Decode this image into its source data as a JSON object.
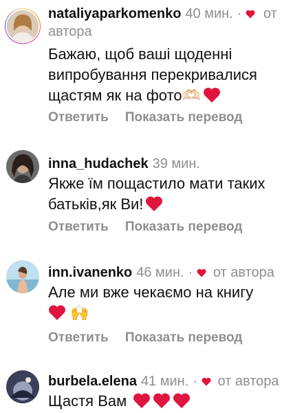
{
  "comments": [
    {
      "username": "nataliyaparkomenko",
      "time": "40 мин.",
      "author_label_line1": "от",
      "author_label_line2": "автора",
      "text": "Бажаю, щоб ваші щоденні випробування перекривалися щастям як на фото🫶🏻",
      "reply": "Ответить",
      "translate": "Показать перевод",
      "avatar_icon": "avatar-photo"
    },
    {
      "username": "inna_hudachek",
      "time": "39 мин.",
      "text": "Якже їм пощастило мати таких батьків,як Ви!",
      "reply": "Ответить",
      "translate": "Показать перевод",
      "avatar_icon": "avatar-photo"
    },
    {
      "username": "inn.ivanenko",
      "time": "46 мин.",
      "dot": "·",
      "author_label": "от автора",
      "text": "Але ми вже чекаємо на книгу",
      "emoji_line2": "🙌",
      "reply": "Ответить",
      "translate": "Показать перевод",
      "avatar_icon": "avatar-photo"
    },
    {
      "username": "burbela.elena",
      "time": "41 мин.",
      "dot": "·",
      "author_label": "от автора",
      "text": "Щастя Вам",
      "avatar_icon": "avatar-photo"
    }
  ],
  "colors": {
    "heart": "#e0143c",
    "muted": "#8e8e8e",
    "text": "#111111"
  }
}
